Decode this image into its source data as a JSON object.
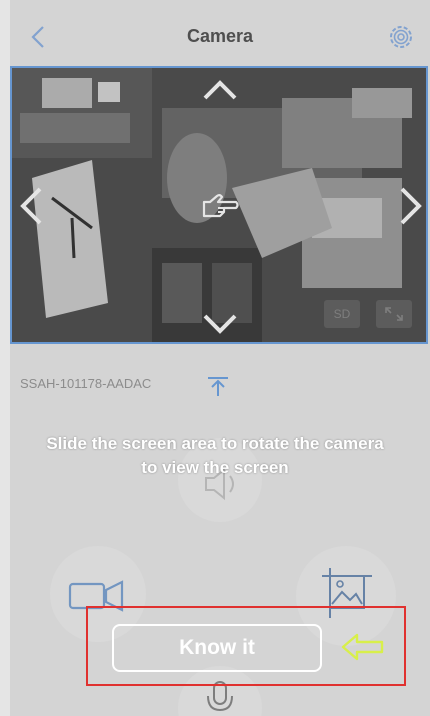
{
  "header": {
    "title": "Camera",
    "back_icon": "chevron-left-icon",
    "settings_icon": "gear-icon"
  },
  "feed": {
    "quality_label": "SD",
    "icons": [
      "arrow-up-icon",
      "arrow-down-icon",
      "arrow-left-icon",
      "arrow-right-icon",
      "pointing-hand-icon",
      "fullscreen-icon"
    ]
  },
  "device": {
    "id": "SSAH-101178-AADAC",
    "icon": "upload-icon"
  },
  "controls": {
    "icons": [
      "speaker-icon",
      "video-record-icon",
      "image-capture-icon",
      "microphone-icon"
    ]
  },
  "guide": {
    "hint_line1": "Slide the screen area to rotate the camera",
    "hint_line2": "to view the screen",
    "button_label": "Know it",
    "pointer_icon": "left-arrow-icon"
  },
  "colors": {
    "accent_blue": "#6fa6e8",
    "highlight_red": "#e0312f",
    "pointer_yellow": "#d8ef4a"
  }
}
